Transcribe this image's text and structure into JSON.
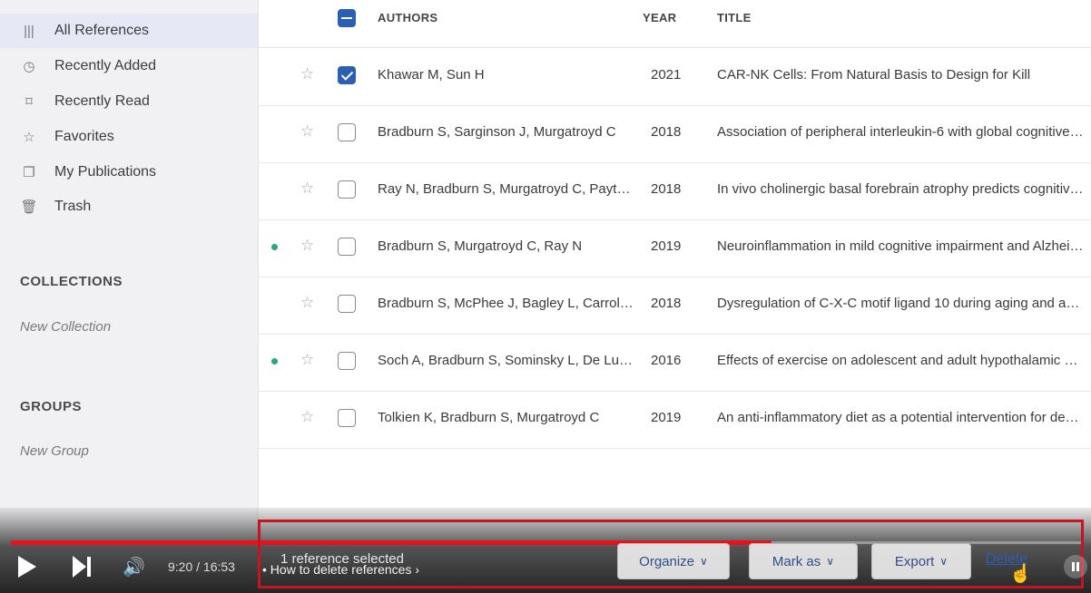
{
  "library": {
    "items": [
      {
        "label": "All References",
        "icon": "library-icon",
        "glyph": "|||"
      },
      {
        "label": "Recently Added",
        "icon": "clock-icon",
        "glyph": "◷"
      },
      {
        "label": "Recently Read",
        "icon": "bookmark-icon",
        "glyph": "⌑"
      },
      {
        "label": "Favorites",
        "icon": "star-icon",
        "glyph": "☆"
      },
      {
        "label": "My Publications",
        "icon": "publication-icon",
        "glyph": "❐"
      },
      {
        "label": "Trash",
        "icon": "trash-icon",
        "glyph": "🗑"
      }
    ],
    "active_index": 0
  },
  "collections": {
    "title": "COLLECTIONS",
    "new_label": "New Collection"
  },
  "groups": {
    "title": "GROUPS",
    "new_label": "New Group"
  },
  "table": {
    "headers": {
      "authors": "AUTHORS",
      "year": "YEAR",
      "title": "TITLE"
    },
    "rows": [
      {
        "authors": "Khawar M, Sun H",
        "year": "2021",
        "title": "CAR-NK Cells: From Natural Basis to Design for Kill",
        "checked": true,
        "unread": false
      },
      {
        "authors": "Bradburn S, Sarginson J, Murgatroyd C",
        "year": "2018",
        "title": "Association of peripheral interleukin-6 with global cognitive decline",
        "checked": false,
        "unread": false
      },
      {
        "authors": "Ray N, Bradburn S, Murgatroyd C, Payton A",
        "year": "2018",
        "title": "In vivo cholinergic basal forebrain atrophy predicts cognitive decline",
        "checked": false,
        "unread": false
      },
      {
        "authors": "Bradburn S, Murgatroyd C, Ray N",
        "year": "2019",
        "title": "Neuroinflammation in mild cognitive impairment and Alzheimer's disease",
        "checked": false,
        "unread": true
      },
      {
        "authors": "Bradburn S, McPhee J, Bagley L, Carroll M",
        "year": "2018",
        "title": "Dysregulation of C-X-C motif ligand 10 during aging and association",
        "checked": false,
        "unread": false
      },
      {
        "authors": "Soch A, Bradburn S, Sominsky L, De Luca SN",
        "year": "2016",
        "title": "Effects of exercise on adolescent and adult hypothalamic and hippocampal",
        "checked": false,
        "unread": true
      },
      {
        "authors": "Tolkien K, Bradburn S, Murgatroyd C",
        "year": "2019",
        "title": "An anti-inflammatory diet as a potential intervention for depressive disorders",
        "checked": false,
        "unread": false
      }
    ]
  },
  "actions": {
    "selected_text": "1 reference selected",
    "organize": "Organize",
    "mark_as": "Mark as",
    "export": "Export",
    "delete": "Delete"
  },
  "video": {
    "time": "9:20 / 16:53",
    "chapter": "• How to delete references ›",
    "progress": 0.71
  },
  "colors": {
    "accent": "#2b5fb4",
    "highlight": "#c8141e",
    "progress": "#e8121b",
    "unread_dot": "#2aa77a"
  }
}
